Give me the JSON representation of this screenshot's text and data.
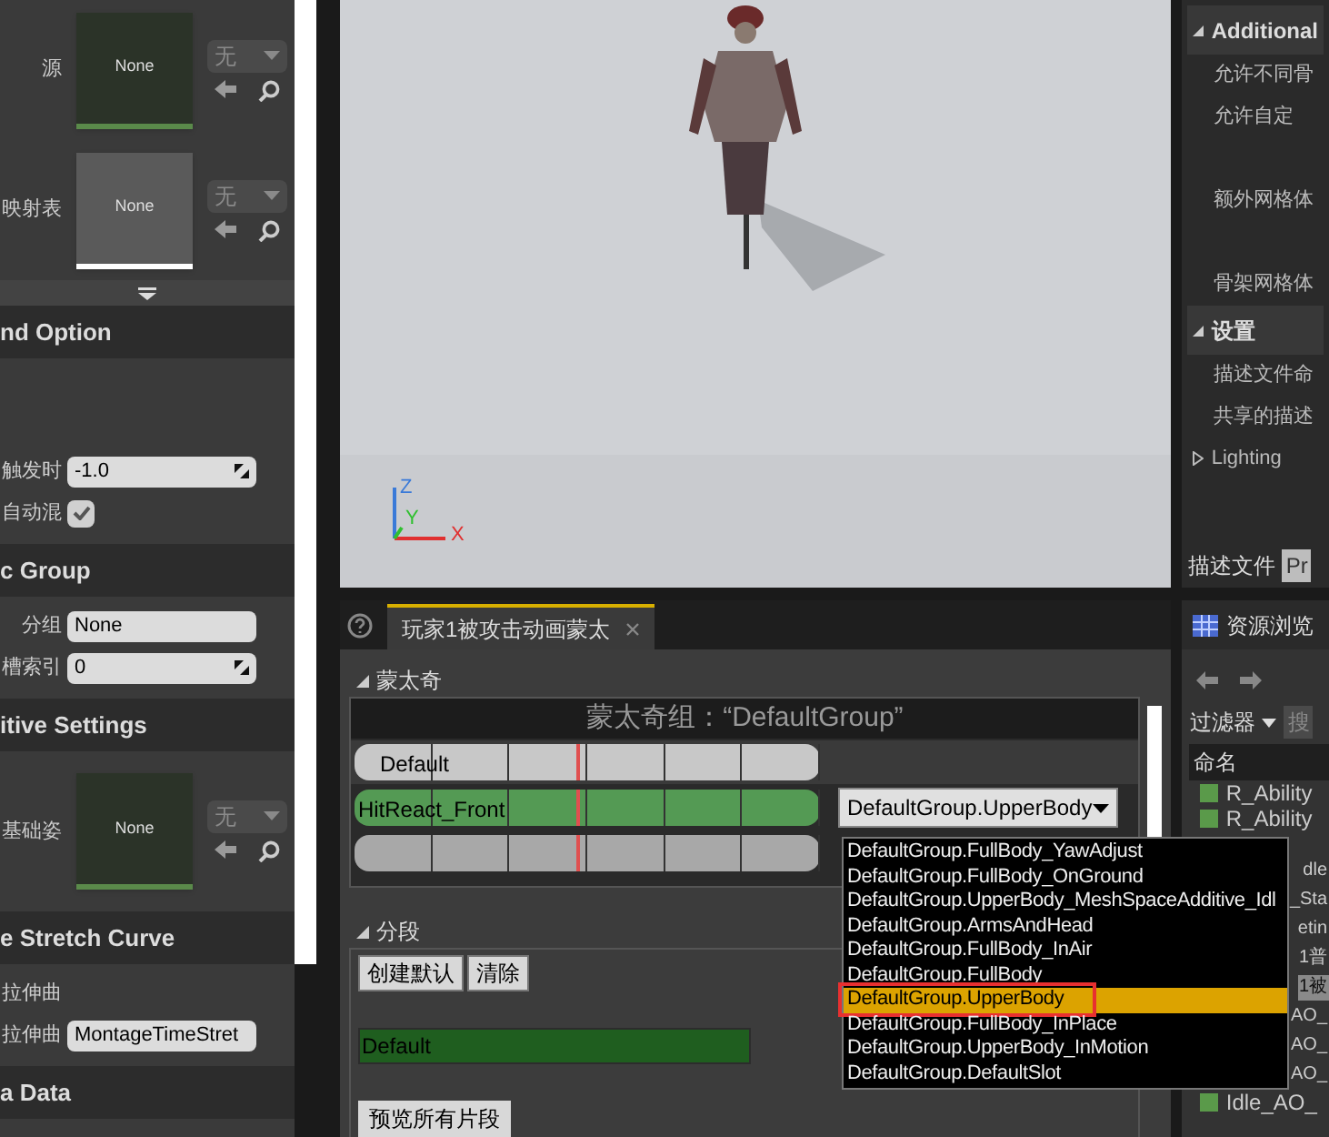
{
  "details": {
    "asset_rows": [
      {
        "label": "源",
        "thumb": "None",
        "color": "#5a8a4a",
        "combo": "无"
      },
      {
        "label": "映射表",
        "thumb": "None",
        "color": "#ffffff",
        "combo": "无"
      }
    ],
    "sections": [
      {
        "title": "nd Option",
        "rows": [
          {
            "kind": "blank"
          },
          {
            "kind": "blank"
          },
          {
            "kind": "number",
            "label": "触发时",
            "value": "-1.0"
          },
          {
            "kind": "check",
            "label": "自动混",
            "checked": true
          }
        ]
      },
      {
        "title": "c Group",
        "rows": [
          {
            "kind": "text",
            "label": "分组",
            "value": "None"
          },
          {
            "kind": "number",
            "label": "槽索引",
            "value": "0"
          }
        ]
      },
      {
        "title": "itive Settings",
        "rows": [
          {
            "kind": "asset",
            "label": "基础姿",
            "thumb": "None",
            "color": "#5a8a4a",
            "combo": "无"
          }
        ]
      },
      {
        "title": "e Stretch Curve",
        "rows": [
          {
            "kind": "label",
            "label": "拉伸曲"
          },
          {
            "kind": "text",
            "label": "拉伸曲",
            "value": "MontageTimeStret"
          }
        ]
      },
      {
        "title": "a Data"
      }
    ]
  },
  "viewport": {
    "axes": [
      "Z",
      "Y",
      "X"
    ]
  },
  "side_panel": {
    "sections": [
      {
        "title": "Additional",
        "rows": [
          "允许不同骨",
          "允许自定",
          "",
          "额外网格体",
          "",
          "骨架网格体"
        ]
      },
      {
        "title": "设置",
        "rows": [
          "描述文件命",
          "共享的描述"
        ]
      }
    ],
    "collapsed": [
      "Lighting"
    ],
    "profile_label": "描述文件",
    "profile_value": "Pr"
  },
  "editor": {
    "tabs": [
      {
        "label": "玩家1被攻击动画蒙太",
        "selected": true
      }
    ],
    "montage": {
      "header": "蒙太奇",
      "title": "蒙太奇组：“DefaultGroup”",
      "tracks": [
        {
          "kind": "section",
          "label": "Default"
        },
        {
          "kind": "slot",
          "label": "HitReact_Front",
          "slot": "DefaultGroup.UpperBody"
        },
        {
          "kind": "empty"
        }
      ]
    },
    "sections": {
      "header": "分段",
      "buttons": [
        "创建默认",
        "清除"
      ],
      "bar": "Default",
      "preview": "预览所有片段"
    },
    "slot_menu": [
      {
        "label": "DefaultGroup.FullBody_YawAdjust",
        "selected": false
      },
      {
        "label": "DefaultGroup.FullBody_OnGround",
        "selected": false
      },
      {
        "label": "DefaultGroup.UpperBody_MeshSpaceAdditive_Idl",
        "selected": false
      },
      {
        "label": "DefaultGroup.ArmsAndHead",
        "selected": false
      },
      {
        "label": "DefaultGroup.FullBody_InAir",
        "selected": false
      },
      {
        "label": "DefaultGroup.FullBody",
        "selected": false
      },
      {
        "label": "DefaultGroup.UpperBody",
        "selected": true
      },
      {
        "label": "DefaultGroup.FullBody_InPlace",
        "selected": false
      },
      {
        "label": "DefaultGroup.UpperBody_InMotion",
        "selected": false
      },
      {
        "label": "DefaultGroup.DefaultSlot",
        "selected": false
      }
    ]
  },
  "browser": {
    "tab": "资源浏览",
    "filter": "过滤器",
    "search": "搜",
    "column": "命名",
    "rows": [
      {
        "kind": "item",
        "label": "R_Ability",
        "selected": false
      },
      {
        "kind": "item",
        "label": "R_Ability",
        "selected": false
      },
      {
        "kind": "hidden"
      },
      {
        "kind": "tail",
        "label": "dle",
        "selected": false
      },
      {
        "kind": "tail",
        "label": "_Sta",
        "selected": false
      },
      {
        "kind": "tail",
        "label": "etin",
        "selected": false
      },
      {
        "kind": "tail",
        "label": "1普",
        "selected": false
      },
      {
        "kind": "tail",
        "label": "1被",
        "selected": true
      },
      {
        "kind": "tail",
        "label": "AO_",
        "selected": false
      },
      {
        "kind": "tail",
        "label": "AO_",
        "selected": false
      },
      {
        "kind": "tail",
        "label": "AO_",
        "selected": false
      },
      {
        "kind": "item",
        "label": "Idle_AO_",
        "selected": false
      }
    ]
  }
}
